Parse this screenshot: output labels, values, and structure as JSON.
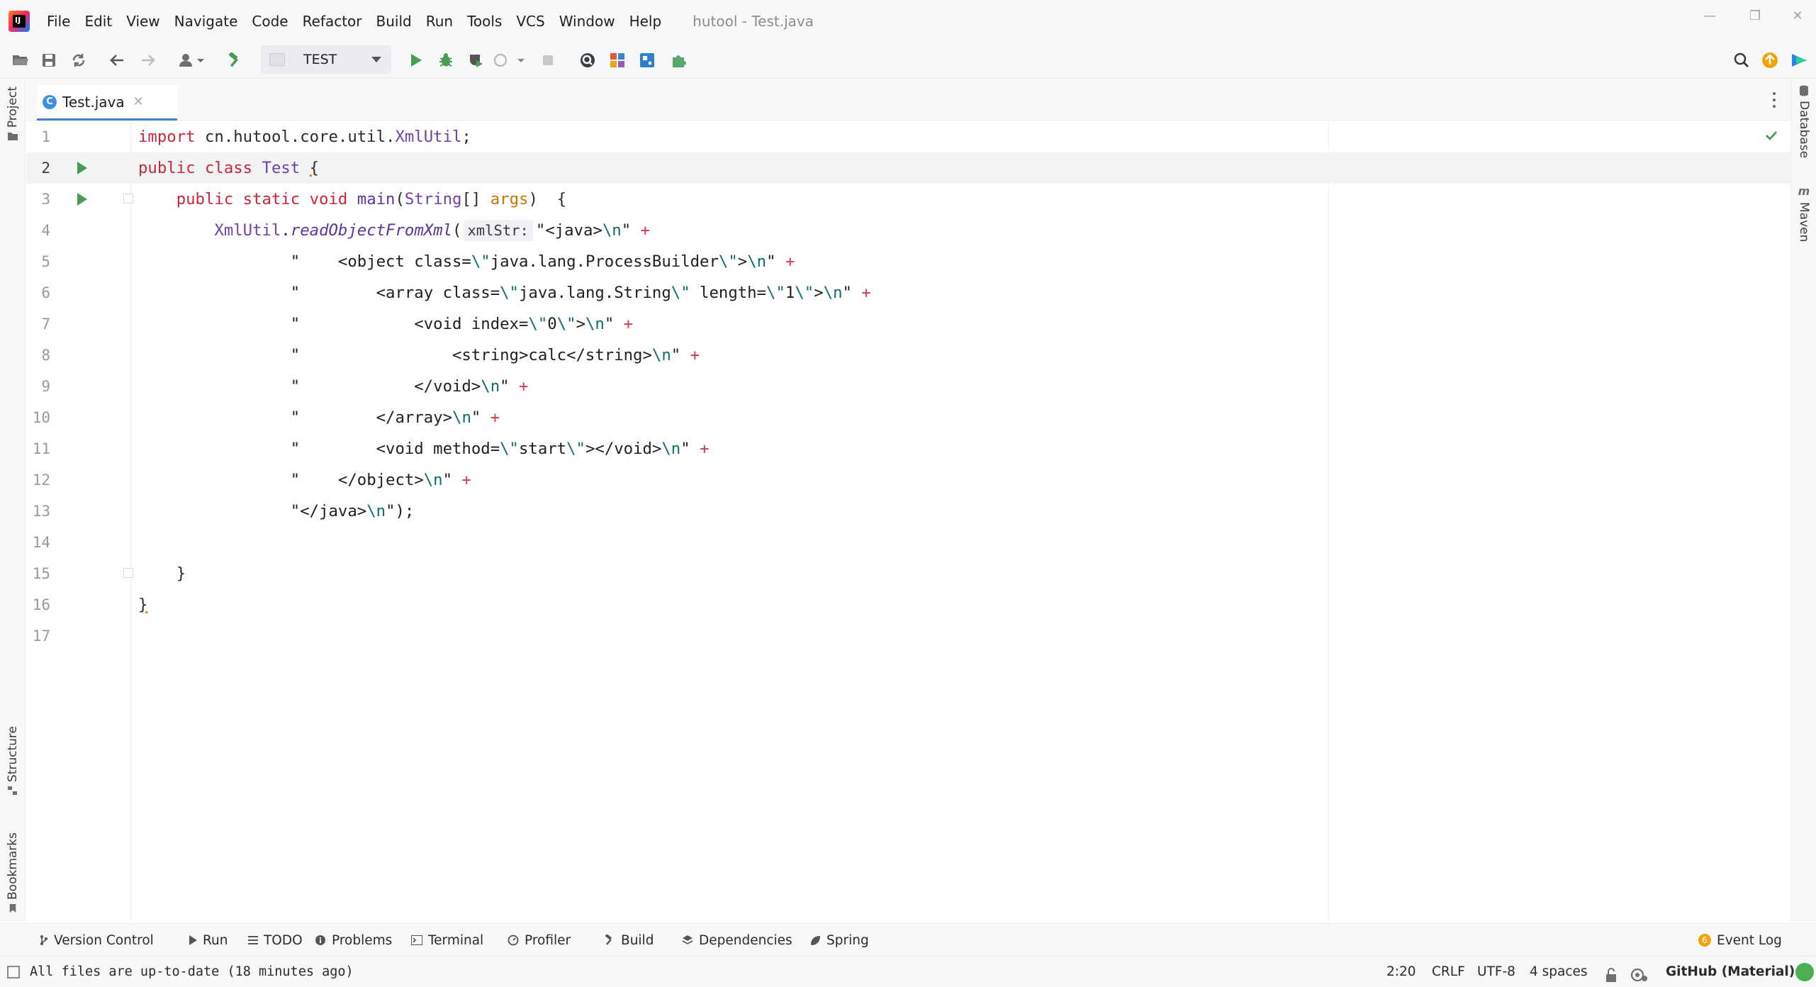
{
  "window": {
    "title": "hutool - Test.java"
  },
  "menu": [
    "File",
    "Edit",
    "View",
    "Navigate",
    "Code",
    "Refactor",
    "Build",
    "Run",
    "Tools",
    "VCS",
    "Window",
    "Help"
  ],
  "toolbar": {
    "run_config": "TEST"
  },
  "left_tools": {
    "project": "Project",
    "structure": "Structure",
    "bookmarks": "Bookmarks"
  },
  "right_tools": {
    "database": "Database",
    "maven": "Maven"
  },
  "tab": {
    "label": "Test.java",
    "icon": "C"
  },
  "editor": {
    "caret_line": 2,
    "lines": [
      {
        "n": "1"
      },
      {
        "n": "2"
      },
      {
        "n": "3"
      },
      {
        "n": "4"
      },
      {
        "n": "5"
      },
      {
        "n": "6"
      },
      {
        "n": "7"
      },
      {
        "n": "8"
      },
      {
        "n": "9"
      },
      {
        "n": "10"
      },
      {
        "n": "11"
      },
      {
        "n": "12"
      },
      {
        "n": "13"
      },
      {
        "n": "14"
      },
      {
        "n": "15"
      },
      {
        "n": "16"
      },
      {
        "n": "17"
      }
    ],
    "code": {
      "l1_kw": "import",
      "l1_pkg": " cn.hutool.core.util.",
      "l1_cls": "XmlUtil",
      "l1_end": ";",
      "l2_kw": "public class",
      "l2_sp": " ",
      "l2_cls": "Test",
      "l2_brace": "{",
      "l3_kw": "public static void",
      "l3_fn": "main",
      "l3_p1": "(",
      "l3_type": "String",
      "l3_arr": "[] ",
      "l3_param": "args",
      "l3_p2": ")  {",
      "l4_cls": "XmlUtil",
      "l4_dot": ".",
      "l4_fn": "readObjectFromXml",
      "l4_paren": "(",
      "l4_hint": "xmlStr:",
      "l4_s1": "\"<java>",
      "l4_esc": "\\n",
      "l4_s2": "\"",
      "l4_plus": "+",
      "l5_s1": "\"    <object class=",
      "l5_e1": "\\\"",
      "l5_s2": "java.lang.ProcessBuilder",
      "l5_e2": "\\\"",
      "l5_s3": ">",
      "l5_e3": "\\n",
      "l5_s4": "\"",
      "l5_plus": "+",
      "l6_s1": "\"        <array class=",
      "l6_e1": "\\\"",
      "l6_s2": "java.lang.String",
      "l6_e2": "\\\"",
      "l6_s3": " length=",
      "l6_e3": "\\\"",
      "l6_s4": "1",
      "l6_e4": "\\\"",
      "l6_s5": ">",
      "l6_e5": "\\n",
      "l6_s6": "\"",
      "l6_plus": "+",
      "l7_s1": "\"            <void index=",
      "l7_e1": "\\\"",
      "l7_s2": "0",
      "l7_e2": "\\\"",
      "l7_s3": ">",
      "l7_e3": "\\n",
      "l7_s4": "\"",
      "l7_plus": "+",
      "l8_s1": "\"                <string>calc</string>",
      "l8_e1": "\\n",
      "l8_s2": "\"",
      "l8_plus": "+",
      "l9_s1": "\"            </void>",
      "l9_e1": "\\n",
      "l9_s2": "\"",
      "l9_plus": "+",
      "l10_s1": "\"        </array>",
      "l10_e1": "\\n",
      "l10_s2": "\"",
      "l10_plus": "+",
      "l11_s1": "\"        <void method=",
      "l11_e1": "\\\"",
      "l11_s2": "start",
      "l11_e2": "\\\"",
      "l11_s3": "></void>",
      "l11_e3": "\\n",
      "l11_s4": "\"",
      "l11_plus": "+",
      "l12_s1": "\"    </object>",
      "l12_e1": "\\n",
      "l12_s2": "\"",
      "l12_plus": "+",
      "l13_s1": "\"</java>",
      "l13_e1": "\\n",
      "l13_s2": "\");",
      "l15": "}",
      "l16": "}"
    }
  },
  "tool_windows": [
    "Version Control",
    "Run",
    "TODO",
    "Problems",
    "Terminal",
    "Profiler",
    "Build",
    "Dependencies",
    "Spring"
  ],
  "event_log": {
    "label": "Event Log",
    "count": "6"
  },
  "status": {
    "message": "All files are up-to-date (18 minutes ago)",
    "position": "2:20",
    "line_sep": "CRLF",
    "encoding": "UTF-8",
    "indent": "4 spaces",
    "theme": "GitHub (Material)"
  },
  "colors": {
    "keyword": "#c9283c",
    "class": "#6f42a6",
    "param": "#c67a00",
    "run": "#499c54",
    "accent": "#4083c9"
  }
}
